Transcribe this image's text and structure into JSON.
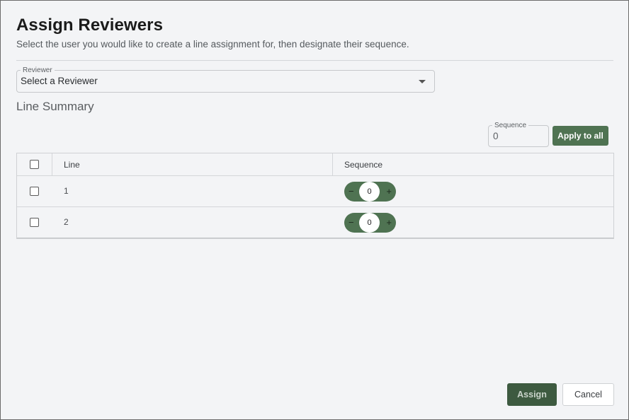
{
  "dialog": {
    "title": "Assign Reviewers",
    "subtitle": "Select the user you would like to create a line assignment for, then designate their sequence."
  },
  "reviewer": {
    "label": "Reviewer",
    "value": "Select a Reviewer"
  },
  "line_summary": {
    "title": "Line Summary",
    "sequence_field": {
      "label": "Sequence",
      "value": "0"
    },
    "apply_label": "Apply to all"
  },
  "table": {
    "columns": [
      "Line",
      "Sequence"
    ],
    "rows": [
      {
        "line": "1",
        "sequence": "0",
        "checked": false
      },
      {
        "line": "2",
        "sequence": "0",
        "checked": false
      }
    ],
    "stepper_minus": "−",
    "stepper_plus": "+"
  },
  "footer": {
    "assign_label": "Assign",
    "cancel_label": "Cancel"
  },
  "colors": {
    "accent": "#4f7352",
    "assign": "#3d5a40",
    "background": "#f3f4f6"
  }
}
